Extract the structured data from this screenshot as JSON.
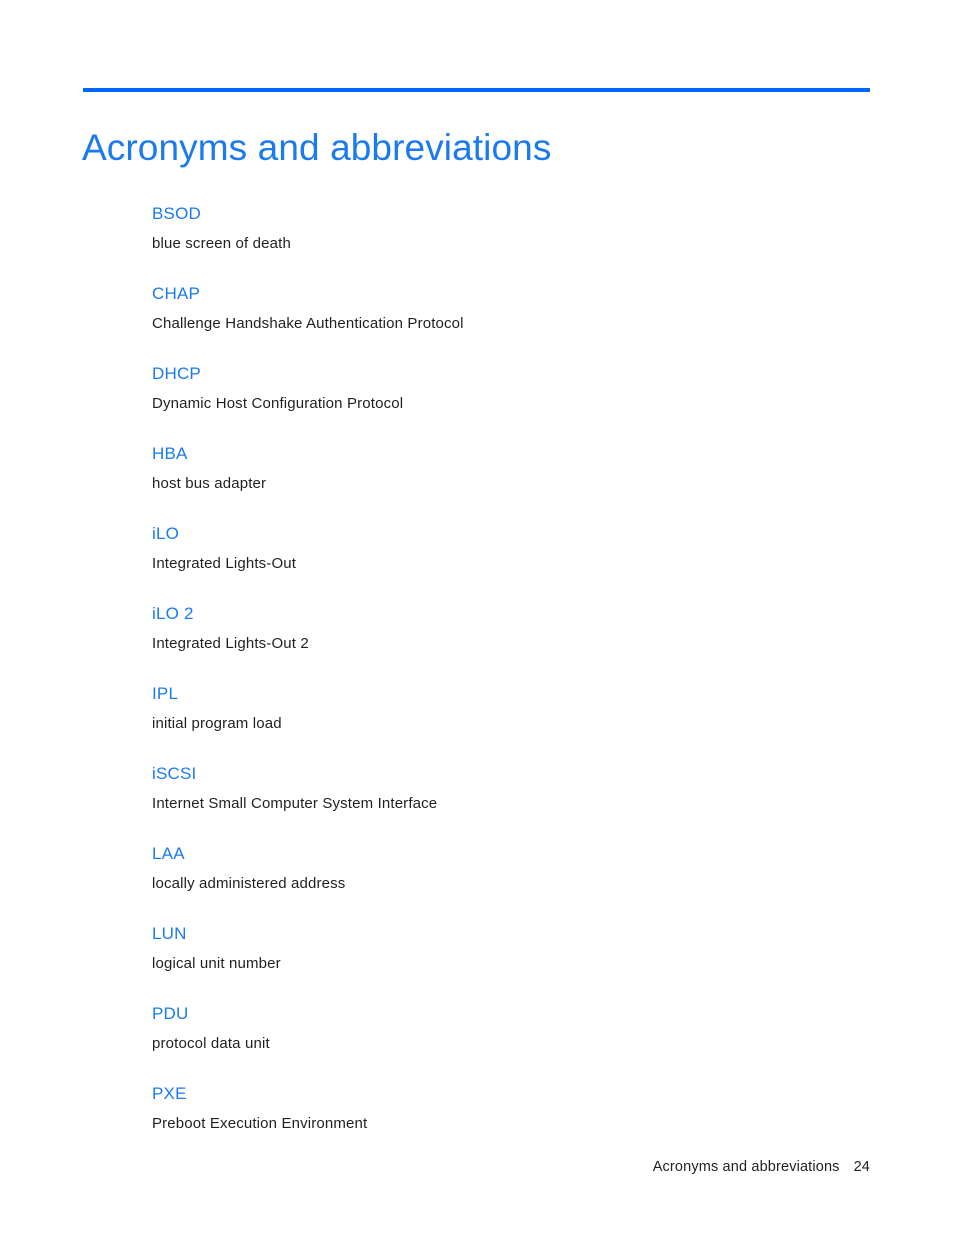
{
  "document": {
    "title": "Acronyms and abbreviations",
    "accent_color": "#0066f5",
    "term_color": "#1a7aee",
    "text_color": "#231f20"
  },
  "entries": [
    {
      "term": "BSOD",
      "definition": "blue screen of death"
    },
    {
      "term": "CHAP",
      "definition": "Challenge Handshake Authentication Protocol"
    },
    {
      "term": "DHCP",
      "definition": "Dynamic Host Configuration Protocol"
    },
    {
      "term": "HBA",
      "definition": "host bus adapter"
    },
    {
      "term": "iLO",
      "definition": "Integrated Lights-Out"
    },
    {
      "term": "iLO 2",
      "definition": "Integrated Lights-Out 2"
    },
    {
      "term": "IPL",
      "definition": "initial program load"
    },
    {
      "term": "iSCSI",
      "definition": "Internet Small Computer System Interface"
    },
    {
      "term": "LAA",
      "definition": "locally administered address"
    },
    {
      "term": "LUN",
      "definition": "logical unit number"
    },
    {
      "term": "PDU",
      "definition": "protocol data unit"
    },
    {
      "term": "PXE",
      "definition": "Preboot Execution Environment"
    }
  ],
  "footer": {
    "label": "Acronyms and abbreviations",
    "page_number": "24"
  }
}
